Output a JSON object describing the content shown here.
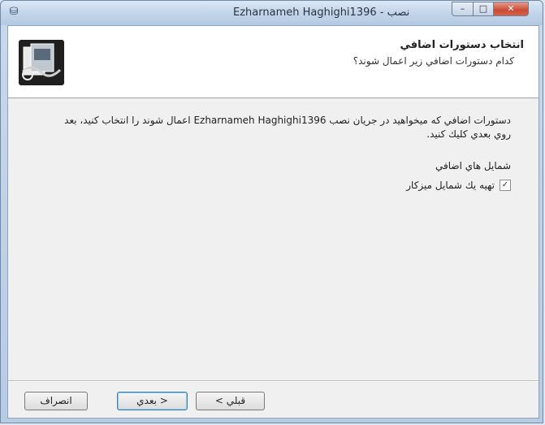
{
  "window": {
    "title": "Ezharnameh Haghighi1396 - نصب",
    "app_icon": "setup-icon",
    "minimize_glyph": "–",
    "maximize_glyph": "□",
    "close_glyph": "✕"
  },
  "header": {
    "title": "انتخاب دستورات اضافي",
    "subtitle": "كدام دستورات اضافي زير اعمال شوند؟",
    "icon": "computer-setup-icon"
  },
  "body": {
    "instructions": "دستورات اضافي كه ميخواهيد در جريان نصب Ezharnameh Haghighi1396 اعمال شوند را انتخاب كنيد، بعد روي بعدي كليك كنيد.",
    "group_label": "شمايل هاي اضافي",
    "checkbox_label": "تهيه يك شمايل ميزكار",
    "checkbox_checked": true
  },
  "footer": {
    "back_label": "< قبلي",
    "next_label": "بعدي >",
    "cancel_label": "انصراف"
  }
}
